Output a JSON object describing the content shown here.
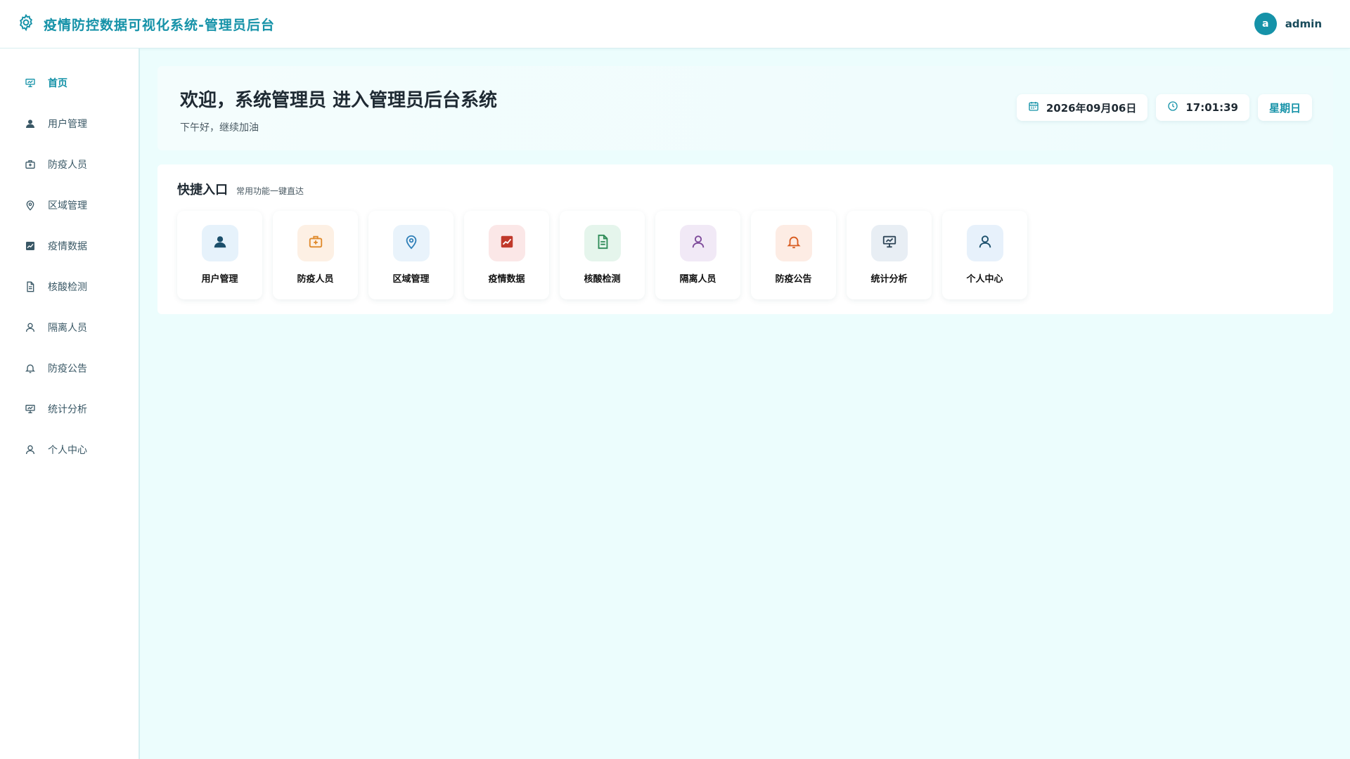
{
  "header": {
    "title": "疫情防控数据可视化系统-管理员后台",
    "avatar_letter": "a",
    "username": "admin"
  },
  "sidebar": {
    "items": [
      {
        "label": "首页",
        "icon": "presentation-icon"
      },
      {
        "label": "用户管理",
        "icon": "user-filled-icon"
      },
      {
        "label": "防疫人员",
        "icon": "medical-kit-icon"
      },
      {
        "label": "区域管理",
        "icon": "location-icon"
      },
      {
        "label": "疫情数据",
        "icon": "chart-icon"
      },
      {
        "label": "核酸检测",
        "icon": "document-icon"
      },
      {
        "label": "隔离人员",
        "icon": "user-icon"
      },
      {
        "label": "防疫公告",
        "icon": "bell-icon"
      },
      {
        "label": "统计分析",
        "icon": "presentation-icon"
      },
      {
        "label": "个人中心",
        "icon": "user-icon"
      }
    ]
  },
  "welcome": {
    "title": "欢迎，系统管理员 进入管理员后台系统",
    "subtitle": "下午好，继续加油",
    "date": "2026年09月06日",
    "time": "17:01:39",
    "weekday": "星期日"
  },
  "quick": {
    "title": "快捷入口",
    "subtitle": "常用功能一键直达",
    "items": [
      {
        "label": "用户管理",
        "bg": "#e6f2fb",
        "color": "#1b4f6b"
      },
      {
        "label": "防疫人员",
        "bg": "#fdf0e4",
        "color": "#e08a2c"
      },
      {
        "label": "区域管理",
        "bg": "#e9f3fb",
        "color": "#2f7fb8"
      },
      {
        "label": "疫情数据",
        "bg": "#fbe7e7",
        "color": "#c0392b"
      },
      {
        "label": "核酸检测",
        "bg": "#e5f5ec",
        "color": "#2e8b57"
      },
      {
        "label": "隔离人员",
        "bg": "#f1e9f6",
        "color": "#7e4a9a"
      },
      {
        "label": "防疫公告",
        "bg": "#fdece4",
        "color": "#d85a1e"
      },
      {
        "label": "统计分析",
        "bg": "#e8eef4",
        "color": "#2f4658"
      },
      {
        "label": "个人中心",
        "bg": "#e7f1fb",
        "color": "#1b4f6b"
      }
    ]
  }
}
